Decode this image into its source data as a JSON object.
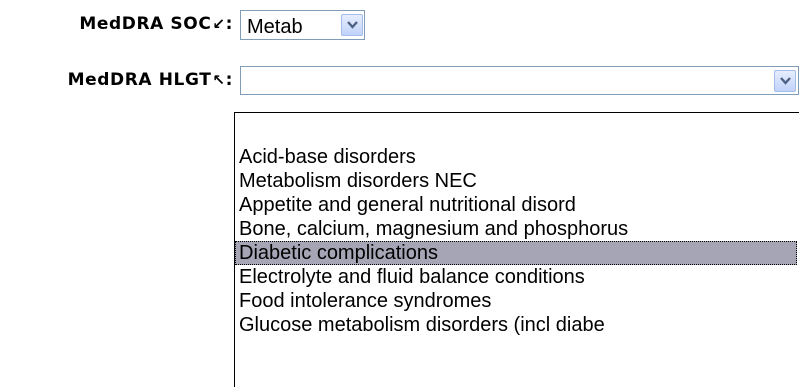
{
  "soc_field": {
    "label": "MedDRA SOC",
    "label_suffix": ":",
    "label_icon": "arrow-down-left-icon",
    "value": "Metab"
  },
  "hlgt_field": {
    "label": "MedDRA HLGT",
    "label_suffix": ":",
    "label_icon": "arrow-up-left-icon",
    "value": ""
  },
  "hlgt_options": [
    "",
    "Acid-base disorders",
    "Metabolism disorders NEC",
    "Appetite and general nutritional disord",
    "Bone, calcium, magnesium and phosphorus",
    "Diabetic complications",
    "Electrolyte and fluid balance conditions",
    "Food intolerance syndromes",
    "Glucose metabolism disorders (incl diabe"
  ],
  "selected_option_index": 5,
  "colors": {
    "select_border": "#7f9db9",
    "selected_option_bg": "#a5a5b6",
    "dropdown_button_bg": "#c1d3fb"
  }
}
